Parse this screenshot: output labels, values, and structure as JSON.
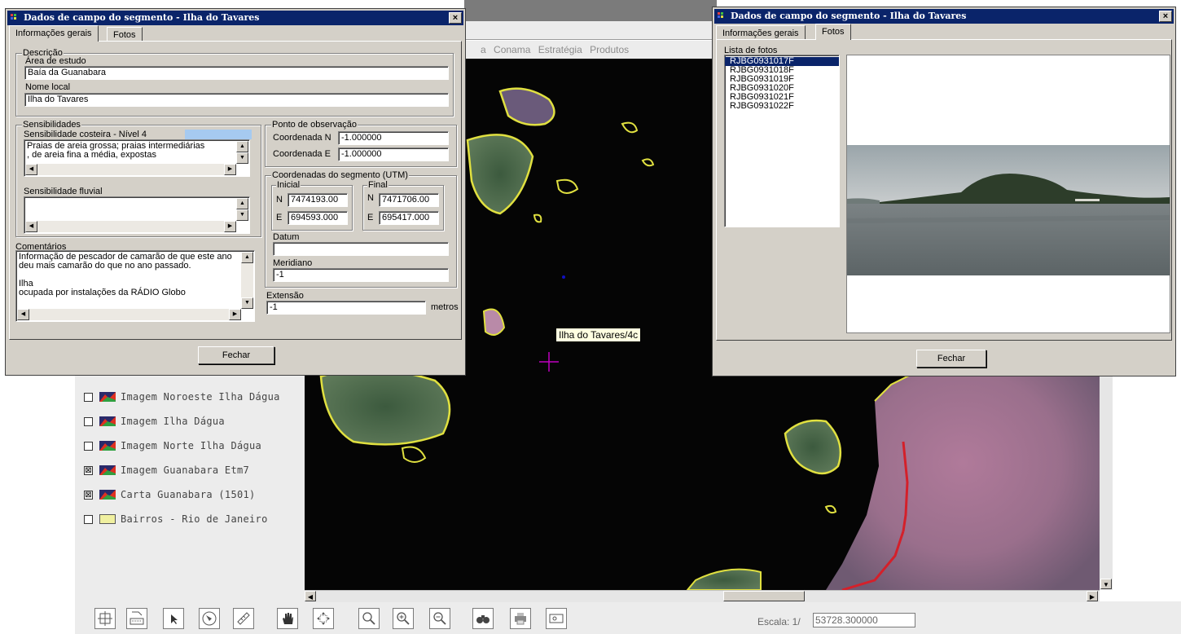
{
  "background_app": {
    "menu_items": [
      "a",
      "Conama",
      "Estratégia",
      "Produtos"
    ],
    "map_tooltip": "Ilha do Tavares/4c",
    "layers": [
      {
        "checked": false,
        "label": "Imagem Noroeste Ilha Dágua",
        "icon": "raster-image-icon"
      },
      {
        "checked": false,
        "label": "Imagem Ilha Dágua",
        "icon": "raster-image-icon"
      },
      {
        "checked": false,
        "label": "Imagem Norte Ilha Dágua",
        "icon": "raster-image-icon"
      },
      {
        "checked": true,
        "label": "Imagem Guanabara Etm7",
        "icon": "raster-image-icon"
      },
      {
        "checked": true,
        "label": "Carta Guanabara (1501)",
        "icon": "raster-image-icon"
      },
      {
        "checked": false,
        "label": "Bairros - Rio de Janeiro",
        "icon": "polygon-layer-icon"
      }
    ],
    "check_mark": "⊠",
    "toolbar_tools": [
      "select-area-tool",
      "keyboard-tool",
      "pointer-tool",
      "identify-tool",
      "measure-tool",
      "pan-hand-tool",
      "full-extent-tool",
      "zoom-tool",
      "zoom-in-tool",
      "zoom-out-tool",
      "binoculars-tool",
      "print-tool",
      "overview-tool"
    ],
    "scale_label": "Escala: 1/",
    "scale_value": "53728.300000"
  },
  "info_window": {
    "title": "Dados de campo do segmento - Ilha do Tavares",
    "close_label": "×",
    "tabs": [
      "Informações gerais",
      "Fotos"
    ],
    "active_tab": "Informações gerais",
    "descricao": {
      "group_label": "Descrição",
      "area_label": "Área de estudo",
      "area_value": "Baía da Guanabara",
      "nome_label": "Nome local",
      "nome_value": "Ilha do Tavares"
    },
    "sensibilidades": {
      "group_label": "Sensibilidades",
      "costeira_label": "Sensibilidade costeira - Nível 4",
      "costeira_color": "#a6caf0",
      "costeira_text": "Praias de areia grossa; praias intermediárias\n, de areia fina a média, expostas",
      "fluvial_label": "Sensibilidade fluvial",
      "fluvial_text": ""
    },
    "comentarios": {
      "label": "Comentários",
      "text": "Informação de pescador de camarão de que este ano\n deu mais camarão do que no ano passado.\n\nIlha\nocupada por instalações da RÁDIO Globo"
    },
    "ponto_observacao": {
      "group_label": "Ponto de observação",
      "coord_n_label": "Coordenada N",
      "coord_n_value": "-1.000000",
      "coord_e_label": "Coordenada E",
      "coord_e_value": "-1.000000"
    },
    "coordenadas_segmento": {
      "group_label": "Coordenadas do segmento (UTM)",
      "inicial_label": "Inicial",
      "inicial_n_label": "N",
      "inicial_n": "7474193.00",
      "inicial_e_label": "E",
      "inicial_e": "694593.000",
      "final_label": "Final",
      "final_n_label": "N",
      "final_n": "7471706.00",
      "final_e_label": "E",
      "final_e": "695417.000",
      "datum_label": "Datum",
      "datum_value": "",
      "meridiano_label": "Meridiano",
      "meridiano_value": "-1"
    },
    "extensao": {
      "label": "Extensão",
      "value": "-1",
      "unit": "metros"
    },
    "close_button": "Fechar"
  },
  "photos_window": {
    "title": "Dados de campo do segmento - Ilha do Tavares",
    "close_label": "×",
    "tabs": [
      "Informações gerais",
      "Fotos"
    ],
    "active_tab": "Fotos",
    "list_label": "Lista de fotos",
    "photos": [
      "RJBG0931017F",
      "RJBG0931018F",
      "RJBG0931019F",
      "RJBG0931020F",
      "RJBG0931021F",
      "RJBG0931022F"
    ],
    "selected_photo": "RJBG0931017F",
    "close_button": "Fechar"
  }
}
